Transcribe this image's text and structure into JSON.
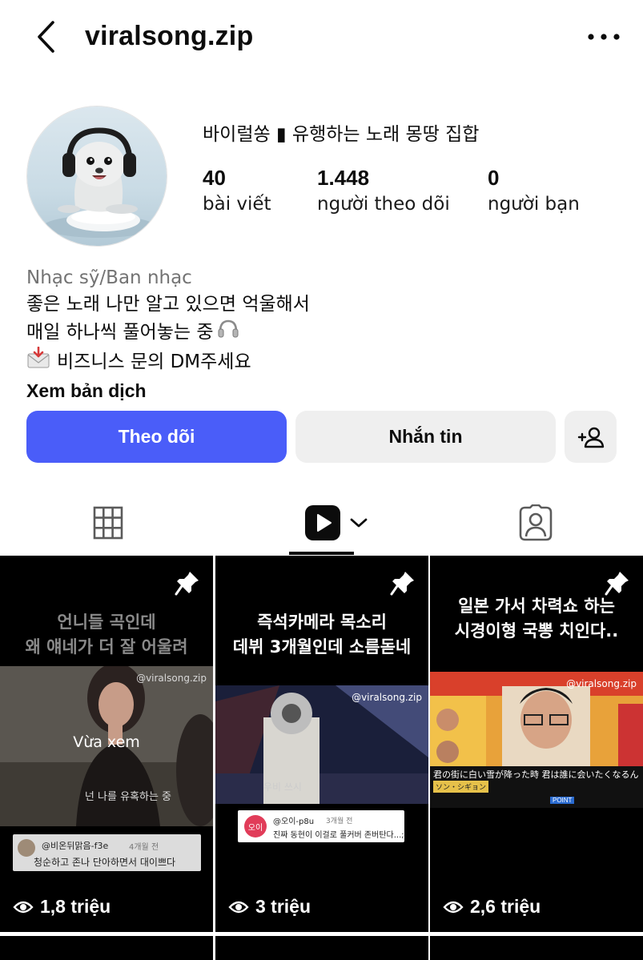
{
  "header": {
    "username": "viralsong.zip"
  },
  "profile": {
    "display_name": "바이럴쏭 ▮ 유행하는 노래 몽땅 집합",
    "stats": [
      {
        "value": "40",
        "label": "bài viết"
      },
      {
        "value": "1.448",
        "label": "người theo dõi"
      },
      {
        "value": "0",
        "label": "người bạn"
      }
    ],
    "category": "Nhạc sỹ/Ban nhạc",
    "bio_lines": [
      "좋은 노래 나만 알고 있으면 억울해서",
      "매일 하나씩 풀어놓는 중",
      "비즈니스 문의 DM주세요"
    ],
    "translate_label": "Xem bản dịch"
  },
  "actions": {
    "follow_label": "Theo dõi",
    "message_label": "Nhắn tin"
  },
  "posts": [
    {
      "caption_line1": "언니들 곡인데",
      "caption_line2": "왜 얘네가 더 잘 어울려",
      "watermark": "@viralsong.zip",
      "subtitle": "넌 나를 유혹하는 중",
      "overlay": "Vừa xem",
      "comment_user": "@비온뒤맑음-f3e",
      "comment_time": "4개월 전",
      "comment_text": "청순하고 존나 단아하면서 대이쁘다",
      "views": "1,8 triệu"
    },
    {
      "caption_line1": "즉석카메라 목소리",
      "caption_line2": "데뷔 3개월인데 소름돋네",
      "watermark": "@viralsong.zip",
      "stage_text": "우비   쓰시",
      "comment_avatar": "오이",
      "comment_user": "@오이-p8u",
      "comment_time": "3개월 전",
      "comment_text": "진짜 동현이 이걸로 풀커버 존버탄다...;;",
      "views": "3 triệu"
    },
    {
      "caption_line1": "일본 가서 차력쇼 하는",
      "caption_line2": "시경이형 국뽕 치인다..",
      "watermark": "@viralsong.zip",
      "jp_line": "君の街に白い雪が降った時 君は誰に会いたくなるん",
      "jp_tag": "ソン・シギョン",
      "jp_point": "POINT",
      "views": "2,6 triệu"
    }
  ],
  "colors": {
    "follow_bg": "#4a5df9",
    "secondary_bg": "#efefef",
    "category_text": "#737373"
  }
}
